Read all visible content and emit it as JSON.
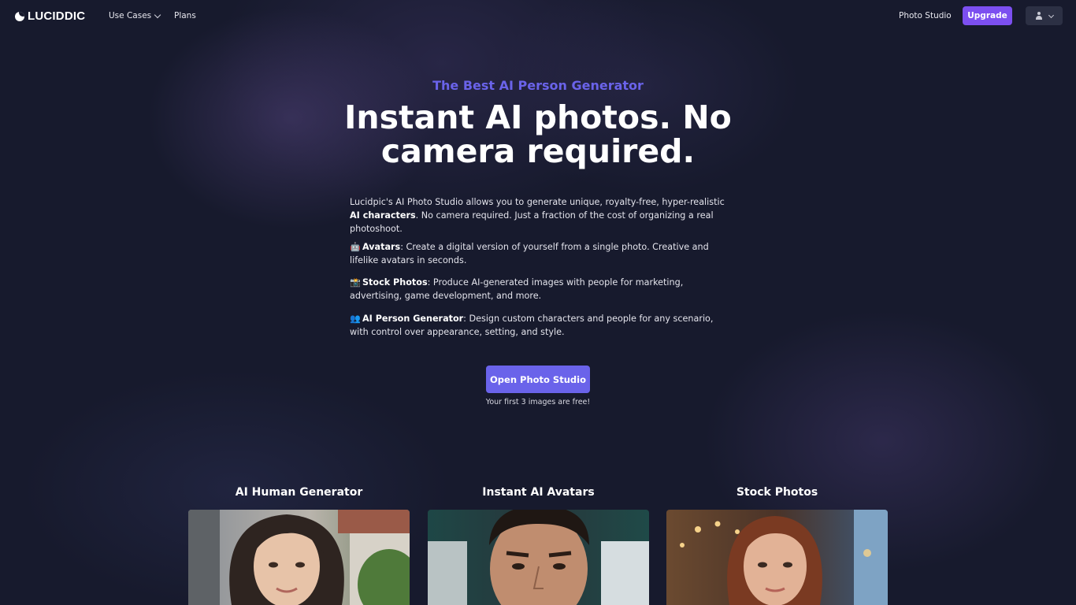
{
  "nav": {
    "logo_text": "LUCIDDIC",
    "links": {
      "use_cases": "Use Cases",
      "plans": "Plans",
      "photo_studio": "Photo Studio"
    },
    "upgrade": "Upgrade"
  },
  "hero": {
    "eyebrow": "The Best AI Person Generator",
    "headline": "Instant AI photos. No camera required.",
    "intro_a": "Lucidpic's AI Photo Studio allows you to generate unique, royalty-free, hyper-realistic ",
    "intro_bold": "AI characters",
    "intro_b": ". No camera required. Just a fraction of the cost of organizing a real photoshoot."
  },
  "features": [
    {
      "emoji": "🤖",
      "title": "Avatars",
      "text": ": Create a digital version of yourself from a single photo. Creative and lifelike avatars in seconds."
    },
    {
      "emoji": "📸",
      "title": "Stock Photos",
      "text": ": Produce AI-generated images with people for marketing, advertising, game development, and more."
    },
    {
      "emoji": "👥",
      "title": "AI Person Generator",
      "text": ": Design custom characters and people for any scenario, with control over appearance, setting, and style."
    }
  ],
  "cta": {
    "label": "Open Photo Studio",
    "note": "Your first 3 images are free!"
  },
  "cards": [
    {
      "title": "AI Human Generator"
    },
    {
      "title": "Instant AI Avatars"
    },
    {
      "title": "Stock Photos"
    }
  ],
  "colors": {
    "background": "#171a2d",
    "accent": "#6a63ea",
    "upgrade": "#7c4ff0"
  }
}
